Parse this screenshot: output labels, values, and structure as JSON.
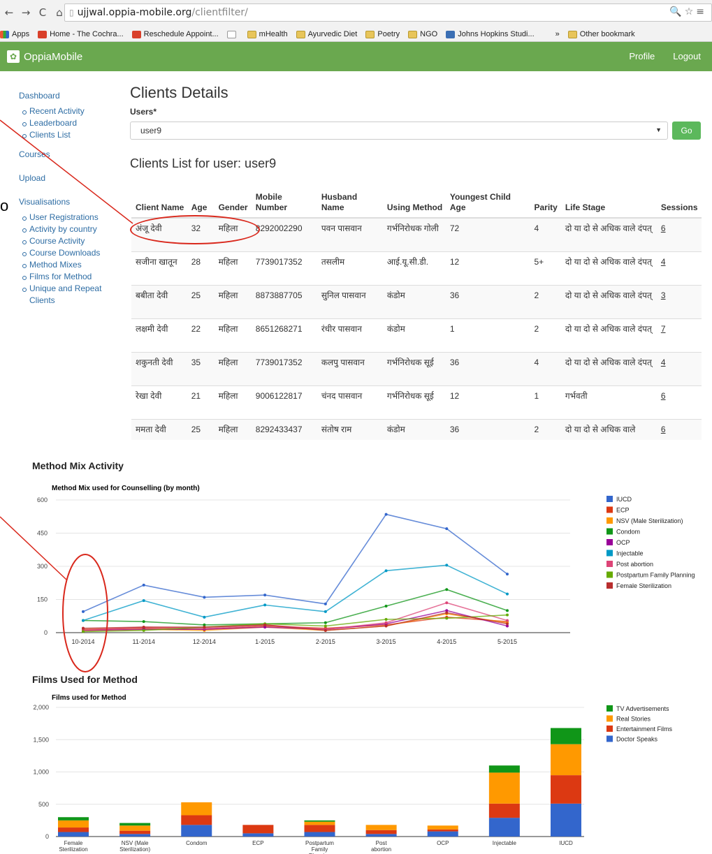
{
  "browser": {
    "url_host": "ujjwal.oppia-mobile.org",
    "url_path": "/clientfilter/",
    "bookmarks": [
      "Apps",
      "Home - The Cochra...",
      "Reschedule Appoint...",
      "",
      "mHealth",
      "Ayurvedic Diet",
      "Poetry",
      "NGO",
      "Johns Hopkins Studi...",
      "»",
      "Other bookmark"
    ]
  },
  "navbar": {
    "brand": "OppiaMobile",
    "profile": "Profile",
    "logout": "Logout"
  },
  "sidebar": {
    "dashboard": "Dashboard",
    "dash_items": [
      "Recent Activity",
      "Leaderboard",
      "Clients List"
    ],
    "courses": "Courses",
    "upload": "Upload",
    "visualisations": "Visualisations",
    "vis_items": [
      "User Registrations",
      "Activity by country",
      "Course Activity",
      "Course Downloads",
      "Method Mixes",
      "Films for Method",
      "Unique and Repeat Clients"
    ]
  },
  "main": {
    "title": "Clients Details",
    "users_label": "Users*",
    "selected_user": "user9",
    "go": "Go",
    "list_title": "Clients List for user: user9"
  },
  "table": {
    "headers": [
      "Client Name",
      "Age",
      "Gender",
      "Mobile Number",
      "Husband Name",
      "Using Method",
      "Youngest Child Age",
      "Parity",
      "Life Stage",
      "Sessions"
    ],
    "rows": [
      [
        "अंजू देवी",
        "32",
        "महिला",
        "8292002290",
        "पवन पासवान",
        "गर्भनिरोधक गोली",
        "72",
        "4",
        "दो या दो से अधिक वाले दंपत्",
        "6"
      ],
      [
        "सजीना खातून",
        "28",
        "महिला",
        "7739017352",
        "तसलीम",
        "आई.यू.सी.डी.",
        "12",
        "5+",
        "दो या दो से अधिक वाले दंपत्",
        "4"
      ],
      [
        "बबीता देवी",
        "25",
        "महिला",
        "8873887705",
        "सुनिल पासवान",
        "कंडोम",
        "36",
        "2",
        "दो या दो से अधिक वाले दंपत्",
        "3"
      ],
      [
        "लक्षमी देवी",
        "22",
        "महिला",
        "8651268271",
        "रंधीर पासवान",
        "कंडोम",
        "1",
        "2",
        "दो या दो से अधिक वाले दंपत्",
        "7"
      ],
      [
        "शकुनती देवी",
        "35",
        "महिला",
        "7739017352",
        "कलपु पासवान",
        "गर्भनिरोधक सूई",
        "36",
        "4",
        "दो या दो से अधिक वाले दंपत्",
        "4"
      ],
      [
        "रेखा देवी",
        "21",
        "महिला",
        "9006122817",
        "चंनद पासवान",
        "गर्भनिरोधक सूई",
        "12",
        "1",
        "गर्भवती",
        "6"
      ],
      [
        "ममता देवी",
        "25",
        "महिला",
        "8292433437",
        "संतोष राम",
        "कंडोम",
        "36",
        "2",
        "दो या दो से अधिक वाले",
        "6"
      ]
    ]
  },
  "chart_data": [
    {
      "type": "line",
      "section_title": "Method Mix Activity",
      "title": "Method Mix used for Counselling (by month)",
      "categories": [
        "10-2014",
        "11-2014",
        "12-2014",
        "1-2015",
        "2-2015",
        "3-2015",
        "4-2015",
        "5-2015"
      ],
      "ylim": [
        0,
        600
      ],
      "yticks": [
        "0",
        "150",
        "300",
        "450",
        "600"
      ],
      "grid": true,
      "legend": "right",
      "series": [
        {
          "name": "IUCD",
          "color": "#3366cc",
          "values": [
            95,
            215,
            160,
            170,
            130,
            535,
            470,
            265
          ]
        },
        {
          "name": "ECP",
          "color": "#dc3912",
          "values": [
            15,
            20,
            15,
            30,
            20,
            35,
            70,
            50
          ]
        },
        {
          "name": "NSV (Male Sterilization)",
          "color": "#ff9900",
          "values": [
            10,
            15,
            10,
            25,
            10,
            30,
            85,
            45
          ]
        },
        {
          "name": "Condom",
          "color": "#109618",
          "values": [
            55,
            50,
            35,
            40,
            45,
            120,
            195,
            100
          ]
        },
        {
          "name": "OCP",
          "color": "#990099",
          "values": [
            10,
            15,
            15,
            25,
            15,
            40,
            100,
            30
          ]
        },
        {
          "name": "Injectable",
          "color": "#0099c6",
          "values": [
            55,
            145,
            70,
            125,
            95,
            280,
            305,
            175
          ]
        },
        {
          "name": "Post abortion",
          "color": "#dd4477",
          "values": [
            10,
            25,
            20,
            35,
            15,
            45,
            135,
            55
          ]
        },
        {
          "name": "Postpartum Family Planning",
          "color": "#66aa00",
          "values": [
            5,
            10,
            25,
            40,
            30,
            60,
            65,
            80
          ]
        },
        {
          "name": "Female Sterilization",
          "color": "#b82e2e",
          "values": [
            20,
            25,
            25,
            35,
            10,
            30,
            90,
            40
          ]
        }
      ]
    },
    {
      "type": "bar",
      "stacked": true,
      "section_title": "Films Used for Method",
      "title": "Films used for Method",
      "categories": [
        "Female Sterilization",
        "NSV (Male Sterilization)",
        "Condom",
        "ECP",
        "Postpartum Family Planning",
        "Post abortion",
        "OCP",
        "Injectable",
        "IUCD"
      ],
      "ylim": [
        0,
        2000
      ],
      "yticks": [
        "0",
        "500",
        "1,000",
        "1,500",
        "2,000"
      ],
      "grid": true,
      "legend": "right",
      "series": [
        {
          "name": "Doctor Speaks",
          "color": "#3366cc",
          "values": [
            70,
            40,
            180,
            50,
            70,
            40,
            80,
            290,
            510
          ]
        },
        {
          "name": "Entertainment Films",
          "color": "#dc3912",
          "values": [
            70,
            50,
            150,
            130,
            110,
            60,
            30,
            220,
            440
          ]
        },
        {
          "name": "Real Stories",
          "color": "#ff9900",
          "values": [
            110,
            80,
            200,
            0,
            50,
            80,
            60,
            480,
            480
          ]
        },
        {
          "name": "TV Advertisements",
          "color": "#109618",
          "values": [
            50,
            40,
            0,
            0,
            20,
            0,
            0,
            110,
            250
          ]
        }
      ]
    }
  ]
}
